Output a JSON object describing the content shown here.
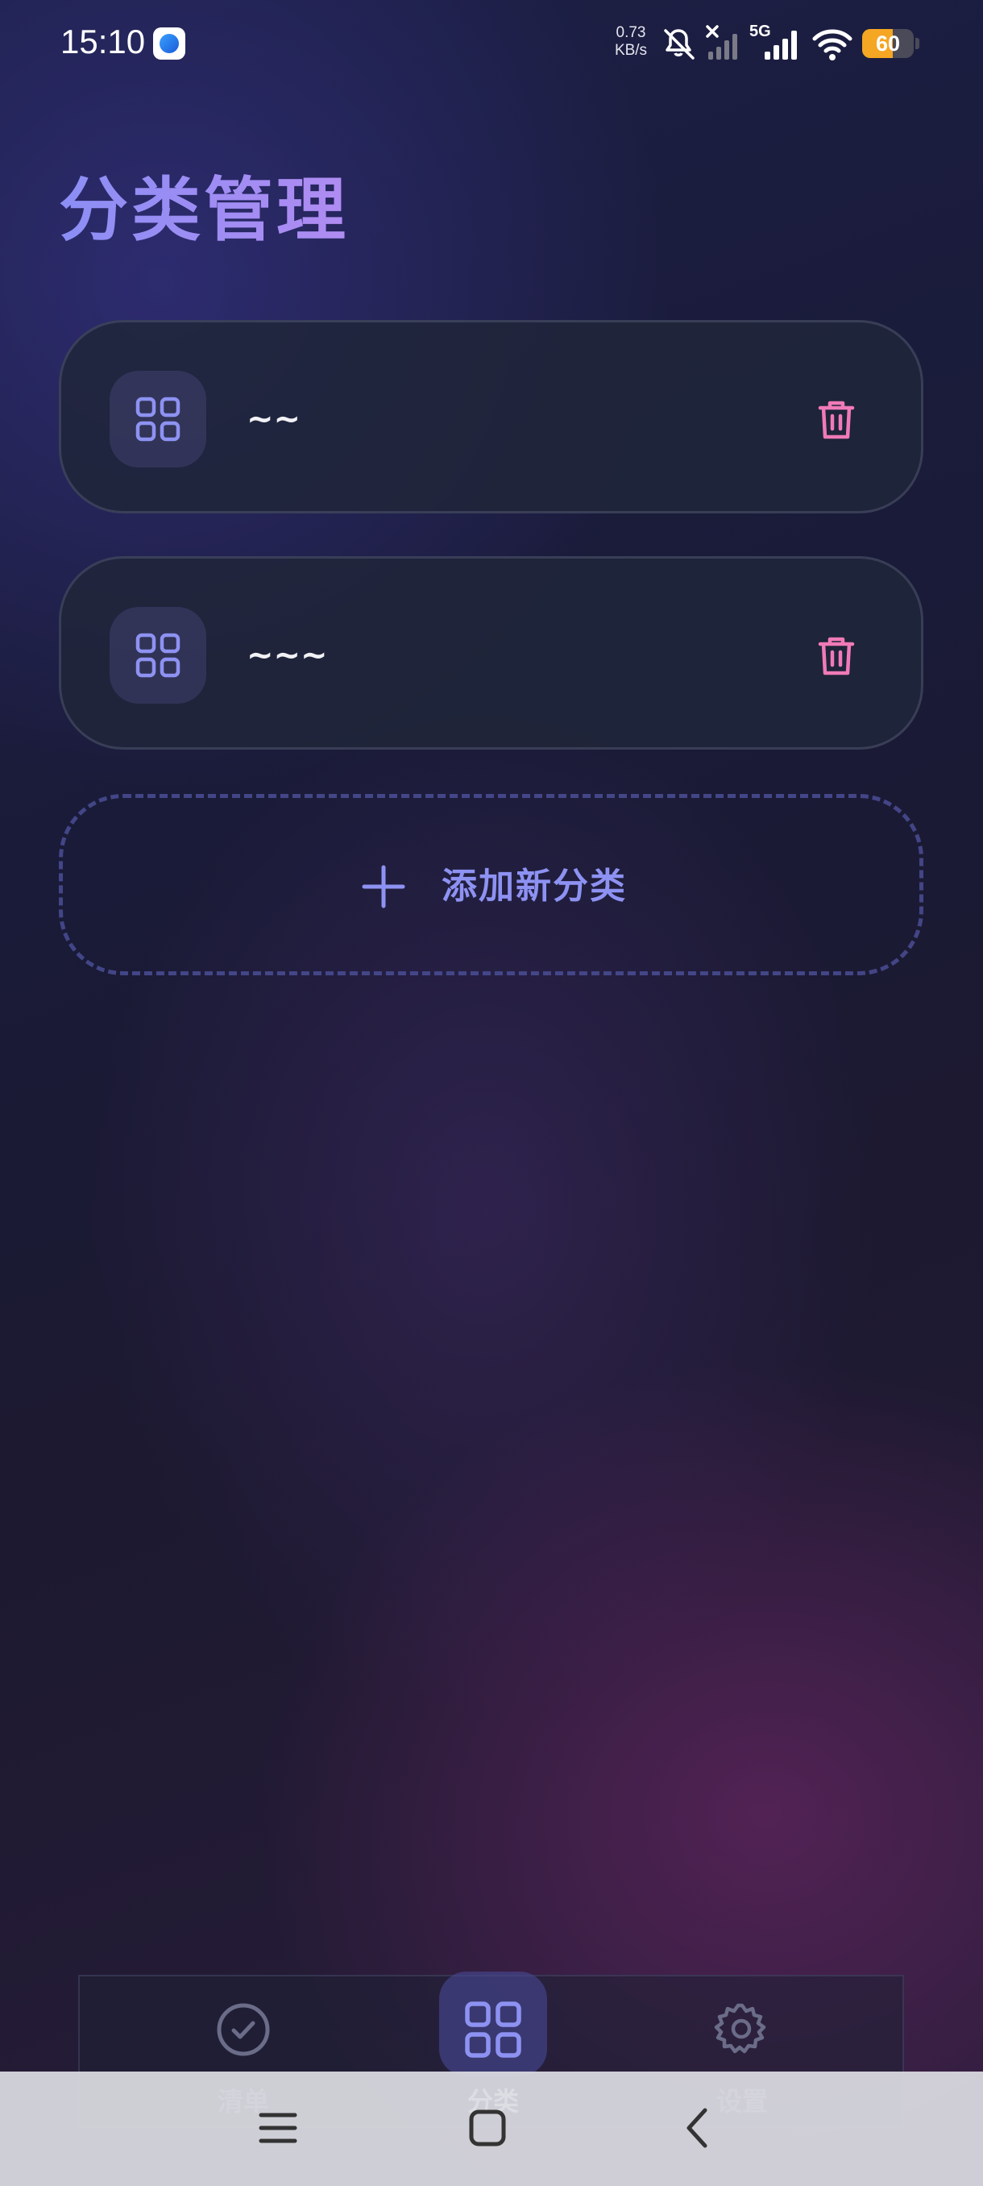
{
  "status_bar": {
    "time": "15:10",
    "net_speed_value": "0.73",
    "net_speed_unit": "KB/s",
    "network_type": "5G",
    "battery_level": "60",
    "battery_fraction": 0.6
  },
  "page": {
    "title": "分类管理"
  },
  "categories": [
    {
      "name": "~~"
    },
    {
      "name": "~~~"
    }
  ],
  "add_button": {
    "label": "添加新分类"
  },
  "bottom_nav": {
    "items": [
      {
        "label": "清单",
        "icon": "check-circle-icon",
        "active": false
      },
      {
        "label": "分类",
        "icon": "grid-icon",
        "active": true
      },
      {
        "label": "设置",
        "icon": "gear-icon",
        "active": false
      }
    ]
  },
  "colors": {
    "accent": "#8d92f2",
    "delete": "#f07ab8",
    "battery": "#f5a623"
  }
}
